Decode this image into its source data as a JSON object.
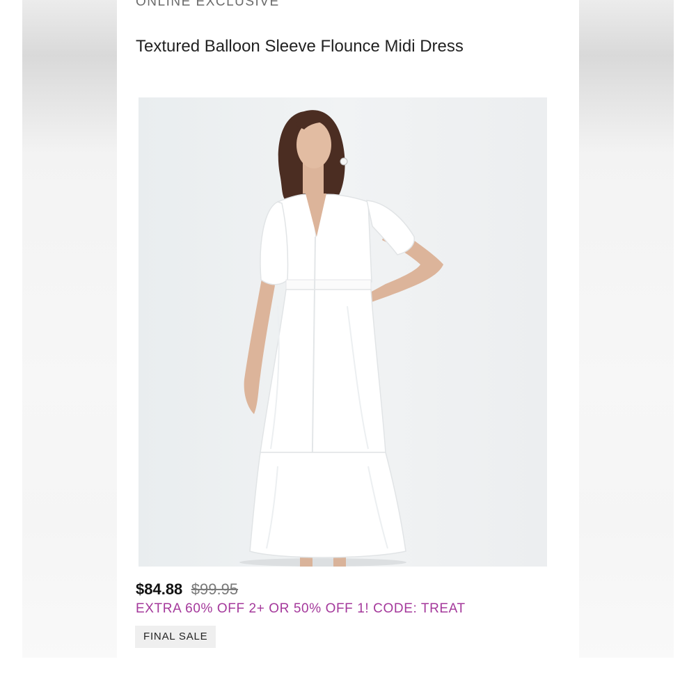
{
  "product": {
    "eyebrow": "ONLINE EXCLUSIVE",
    "title": "Textured Balloon Sleeve Flounce Midi Dress",
    "image_alt": "Model wearing white textured balloon sleeve flounce midi dress",
    "price_current": "$84.88",
    "price_original": "$99.95",
    "promo": "EXTRA 60% OFF 2+ OR 50% OFF 1! CODE: TREAT",
    "badge": "FINAL SALE"
  },
  "colors": {
    "promo": "#a4389b",
    "dress": "#ffffff",
    "background": "#eef0f1"
  }
}
